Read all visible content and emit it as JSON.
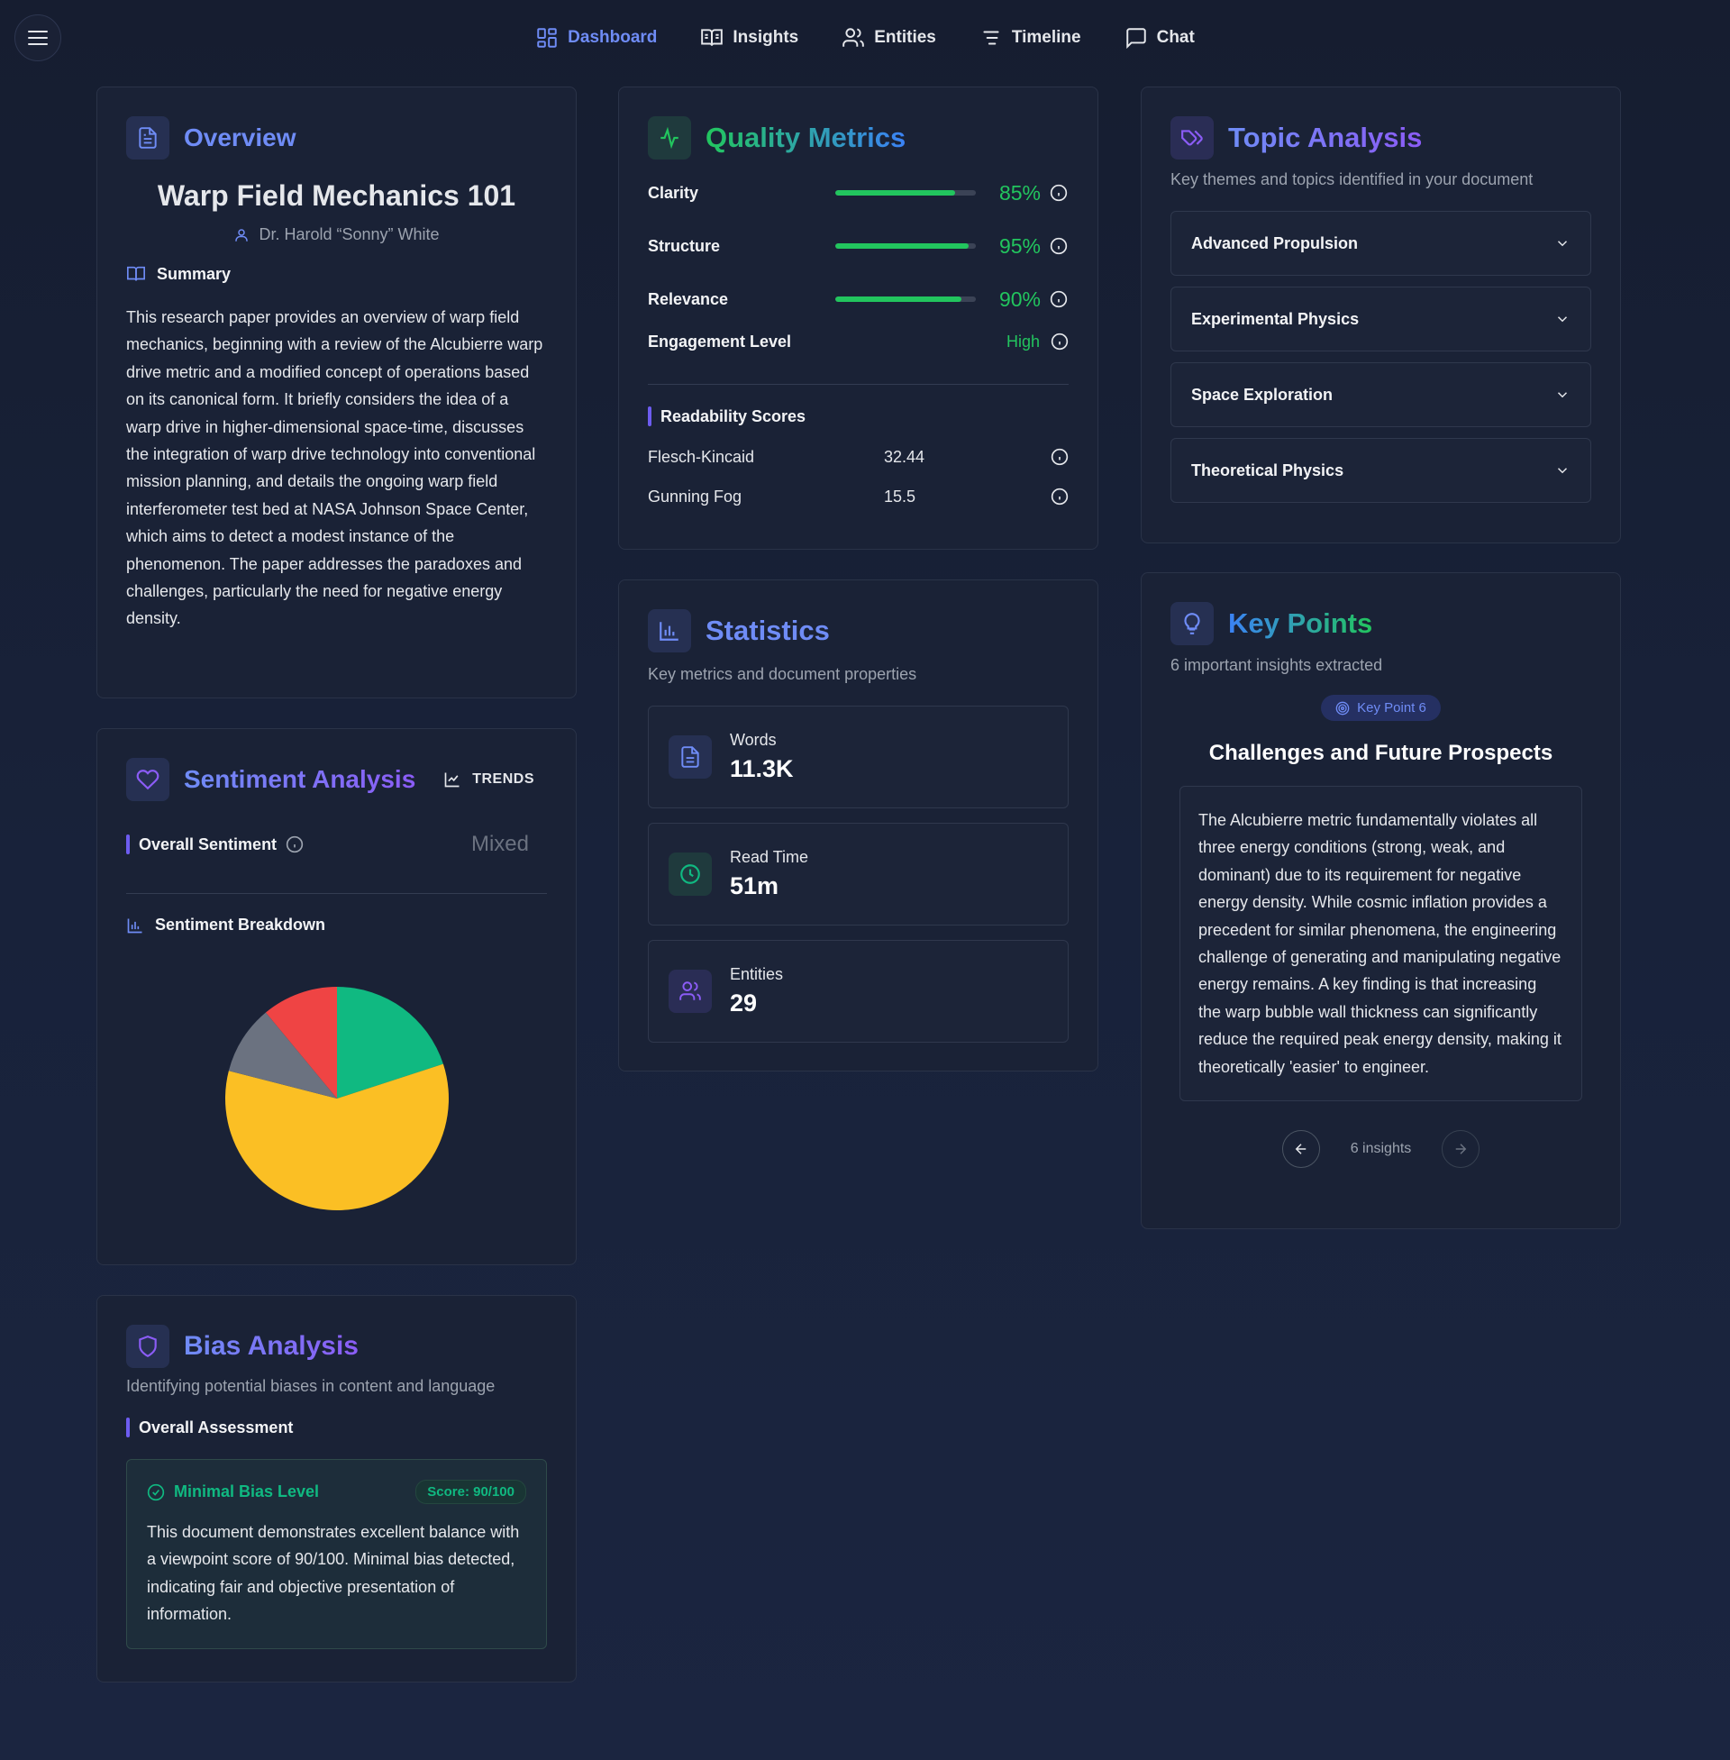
{
  "nav": {
    "items": [
      {
        "label": "Dashboard",
        "icon": "dashboard-icon",
        "active": true
      },
      {
        "label": "Insights",
        "icon": "book-icon"
      },
      {
        "label": "Entities",
        "icon": "users-icon"
      },
      {
        "label": "Timeline",
        "icon": "timeline-icon"
      },
      {
        "label": "Chat",
        "icon": "chat-icon"
      }
    ]
  },
  "overview": {
    "title": "Overview",
    "doc_title": "Warp Field Mechanics 101",
    "author": "Dr. Harold “Sonny” White",
    "summary_label": "Summary",
    "summary": "This research paper provides an overview of warp field mechanics, beginning with a review of the Alcubierre warp drive metric and a modified concept of operations based on its canonical form. It briefly considers the idea of a warp drive in higher-dimensional space-time, discusses the integration of warp drive technology into conventional mission planning, and details the ongoing warp field interferometer test bed at NASA Johnson Space Center, which aims to detect a modest instance of the phenomenon. The paper addresses the paradoxes and challenges, particularly the need for negative energy density."
  },
  "quality": {
    "title": "Quality Metrics",
    "metrics": [
      {
        "label": "Clarity",
        "value": "85%",
        "fraction": 0.85
      },
      {
        "label": "Structure",
        "value": "95%",
        "fraction": 0.95
      },
      {
        "label": "Relevance",
        "value": "90%",
        "fraction": 0.9
      }
    ],
    "engagement_label": "Engagement Level",
    "engagement_value": "High",
    "readability_label": "Readability Scores",
    "readability": [
      {
        "label": "Flesch-Kincaid",
        "value": "32.44"
      },
      {
        "label": "Gunning Fog",
        "value": "15.5"
      }
    ]
  },
  "topics": {
    "title": "Topic Analysis",
    "subtitle": "Key themes and topics identified in your document",
    "items": [
      "Advanced Propulsion",
      "Experimental Physics",
      "Space Exploration",
      "Theoretical Physics"
    ]
  },
  "sentiment": {
    "title": "Sentiment Analysis",
    "trends_label": "TRENDS",
    "overall_label": "Overall Sentiment",
    "overall_value": "Mixed",
    "breakdown_label": "Sentiment Breakdown"
  },
  "chart_data": {
    "type": "pie",
    "categories": [
      "",
      "",
      "",
      ""
    ],
    "values": [
      20,
      59,
      10,
      11
    ],
    "colors": [
      "#10b981",
      "#fbbf24",
      "#6b7280",
      "#ef4444"
    ],
    "title": ""
  },
  "statistics": {
    "title": "Statistics",
    "subtitle": "Key metrics and document properties",
    "items": [
      {
        "label": "Words",
        "value": "11.3K",
        "icon": "document-icon"
      },
      {
        "label": "Read Time",
        "value": "51m",
        "icon": "clock-icon"
      },
      {
        "label": "Entities",
        "value": "29",
        "icon": "users-icon"
      }
    ]
  },
  "keypoints": {
    "title": "Key Points",
    "subtitle": "6 important insights extracted",
    "badge": "Key Point 6",
    "point_title": "Challenges and Future Prospects",
    "point_text": "The Alcubierre metric fundamentally violates all three energy conditions (strong, weak, and dominant) due to its requirement for negative energy density. While cosmic inflation provides a precedent for similar phenomena, the engineering challenge of generating and manipulating negative energy remains. A key finding is that increasing the warp bubble wall thickness can significantly reduce the required peak energy density, making it theoretically 'easier' to engineer.",
    "pager_label": "6 insights"
  },
  "bias": {
    "title": "Bias Analysis",
    "subtitle": "Identifying potential biases in content and language",
    "assessment_label": "Overall Assessment",
    "level": "Minimal Bias Level",
    "score": "Score: 90/100",
    "text": "This document demonstrates excellent balance with a viewpoint score of 90/100. Minimal bias detected, indicating fair and objective presentation of information."
  }
}
